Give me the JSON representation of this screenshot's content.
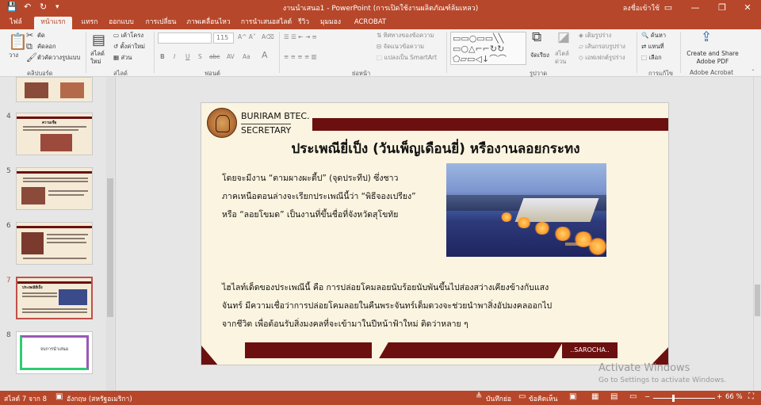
{
  "window": {
    "title": "งานนำเสนอ1 - PowerPoint (การเปิดใช้งานผลิตภัณฑ์ล้มเหลว)",
    "user": "ลงชื่อเข้าใช้",
    "controls": {
      "minimize": "—",
      "restore": "❐",
      "close": "✕",
      "ribbon_display": "▭"
    }
  },
  "quick_access": {
    "save": "💾",
    "undo": "↶",
    "redo": "↻",
    "customize": "▾"
  },
  "tabs": [
    "ไฟล์",
    "หน้าแรก",
    "แทรก",
    "ออกแบบ",
    "การเปลี่ยน",
    "ภาพเคลื่อนไหว",
    "การนำเสนอสไลด์",
    "รีวิว",
    "มุมมอง",
    "ACROBAT"
  ],
  "ribbon": {
    "clipboard": {
      "paste": "วาง",
      "cut": "ตัด",
      "copy": "คัดลอก",
      "format_painter": "ตัวคัดวางรูปแบบ",
      "label": "คลิปบอร์ด"
    },
    "slides": {
      "new_slide": "สไลด์ใหม่",
      "layout": "เค้าโครง",
      "reset": "ตั้งค่าใหม่",
      "section": "ส่วน",
      "label": "สไลด์"
    },
    "font": {
      "size": "115",
      "label": "ฟอนต์",
      "bold": "B",
      "italic": "I",
      "underline": "U",
      "strike": "S",
      "shadow": "abc",
      "spacing": "AV",
      "case": "Aa",
      "color": "A"
    },
    "paragraph": {
      "text_direction": "ทิศทางของข้อความ",
      "align_text": "จัดแนวข้อความ",
      "convert_smartart": "แปลงเป็น SmartArt",
      "label": "ย่อหน้า"
    },
    "drawing": {
      "arrange": "จัดเรียง",
      "quick_styles": "สไตล์ด่วน",
      "shape_fill": "เติมรูปร่าง",
      "shape_outline": "เส้นกรอบรูปร่าง",
      "shape_effects": "เอฟเฟกต์รูปร่าง",
      "label": "รูปวาด"
    },
    "editing": {
      "find": "ค้นหา",
      "replace": "แทนที่",
      "select": "เลือก",
      "label": "การแก้ไข"
    },
    "acrobat": {
      "create_share": "Create and Share",
      "adobe_pdf": "Adobe PDF",
      "label": "Adobe Acrobat"
    }
  },
  "thumbnails": [
    {
      "number": "4",
      "title": "ความเชื่อ"
    },
    {
      "number": "5",
      "title": ""
    },
    {
      "number": "6",
      "title": ""
    },
    {
      "number": "7",
      "title": "ประเพณียี่เป็ง"
    },
    {
      "number": "8",
      "title": "จบการนำเสนอ"
    }
  ],
  "slide": {
    "org_line1": "BURIRAM BTEC.",
    "org_line2": "SECRETARY",
    "title": "ประเพณียี่เป็ง (วันเพ็ญเดือนยี่) หรืองานลอยกระทง",
    "para1": [
      "โดยจะมีงาน “ตามผางผะตี้ป” (จุดประทีป) ซึ่งชาว",
      "ภาคเหนือตอนล่างจะเรียกประเพณีนี้ว่า “พิธีจองเปรียง”",
      "หรือ “ลอยโขมด” เป็นงานที่ขึ้นชื่อที่จังหวัดสุโขทัย"
    ],
    "para2": [
      "ไฮไลท์เด็ดของประเพณีนี้ คือ การปล่อยโคมลอยนับร้อยนับพันขึ้นไปส่องสว่างเคียงข้างกับแสง",
      "จันทร์ มีความเชื่อว่าการปล่อยโคมลอยในคืนพระจันทร์เต็มดวงจะช่วยนำพาสิ่งอัปมงคลออกไป",
      "จากชีวิต เพื่อต้อนรับสิ่งมงคลที่จะเข้ามาในปีหน้าฟ้าใหม่ ติดว่าหลาย ๆ"
    ],
    "footer": "..SAROCHA..",
    "colors": {
      "band": "#6b0f0f",
      "background": "#fbf4e0"
    }
  },
  "watermark": {
    "line1": "Activate Windows",
    "line2": "Go to Settings to activate Windows."
  },
  "status": {
    "slide_info": "สไลด์ 7 จาก 8",
    "language": "อังกฤษ (สหรัฐอเมริกา)",
    "notes": "บันทึกย่อ",
    "comments": "ข้อคิดเห็น",
    "zoom": "66 %",
    "zoom_minus": "−",
    "zoom_plus": "+"
  }
}
